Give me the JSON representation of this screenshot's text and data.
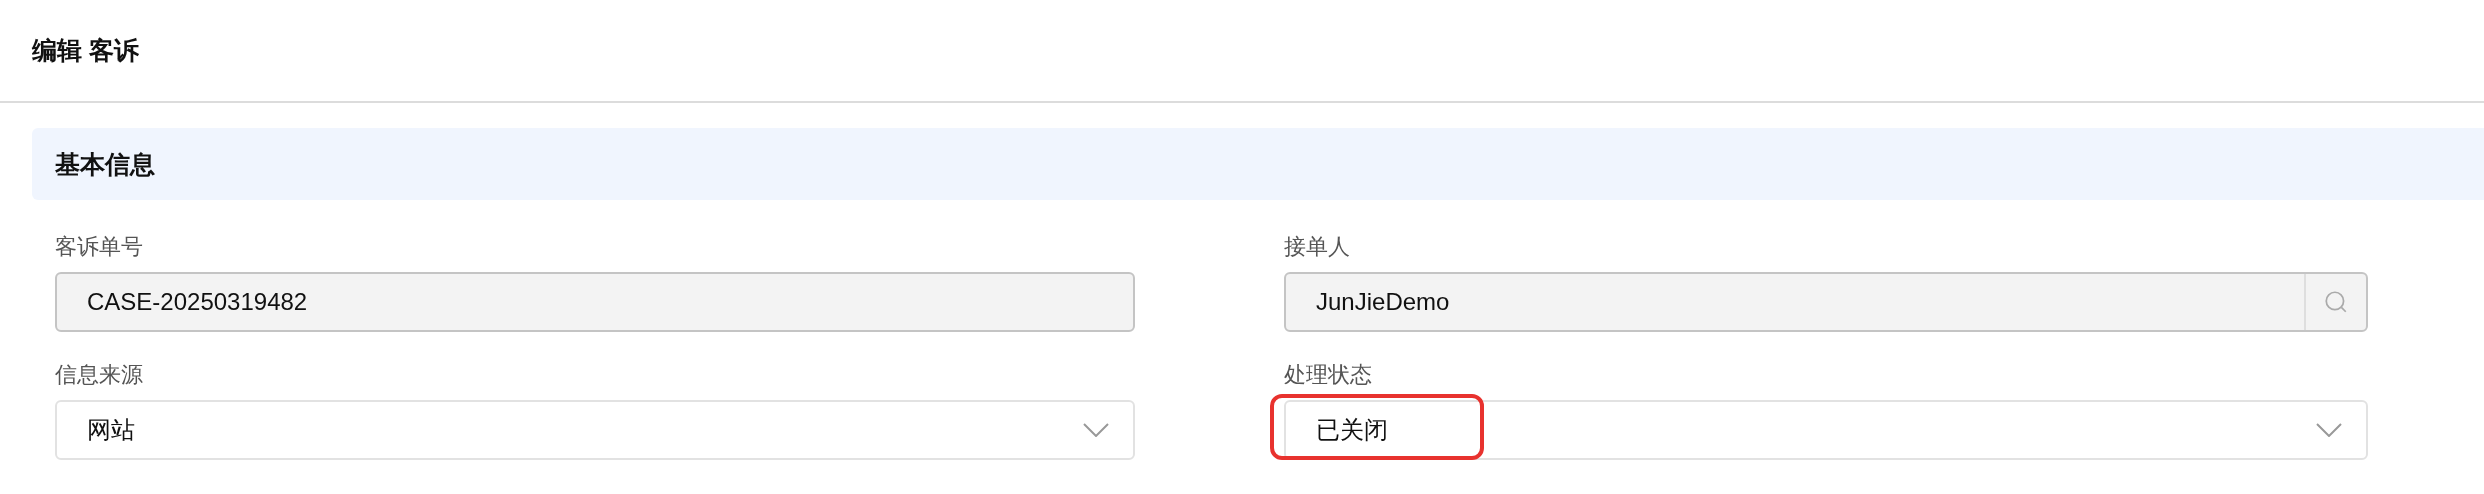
{
  "title": "编辑 客诉",
  "section": {
    "title": "基本信息"
  },
  "fields": [
    {
      "kind": "readonly",
      "label": "客诉单号",
      "value": "CASE-20250319482",
      "highlighted": false
    },
    {
      "kind": "lookup",
      "label": "接单人",
      "value": "JunJieDemo",
      "highlighted": false
    },
    {
      "kind": "select",
      "label": "信息来源",
      "value": "网站",
      "highlighted": false
    },
    {
      "kind": "select",
      "label": "处理状态",
      "value": "已关闭",
      "highlighted": true
    }
  ]
}
